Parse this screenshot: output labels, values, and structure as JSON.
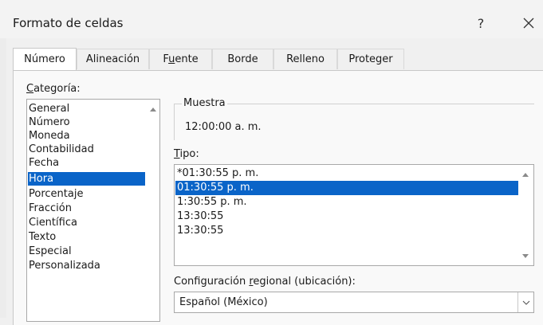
{
  "window": {
    "title": "Formato de celdas",
    "help_label": "?",
    "close_icon": "close-icon"
  },
  "tabs": [
    {
      "label": "Número",
      "active": true
    },
    {
      "label": "Alineación",
      "active": false
    },
    {
      "label_pre": "F",
      "label_u": "u",
      "label_post": "ente",
      "active": false
    },
    {
      "label": "Borde",
      "active": false
    },
    {
      "label": "Relleno",
      "active": false
    },
    {
      "label": "Proteger",
      "active": false
    }
  ],
  "category": {
    "label_u": "C",
    "label_rest": "ategoría:",
    "items": [
      {
        "label": "General"
      },
      {
        "label": "Número"
      },
      {
        "label": "Moneda"
      },
      {
        "label": "Contabilidad"
      },
      {
        "label": "Fecha"
      },
      {
        "label": "Hora",
        "selected": true
      },
      {
        "label": "Porcentaje"
      },
      {
        "label": "Fracción"
      },
      {
        "label": "Científica"
      },
      {
        "label": "Texto"
      },
      {
        "label": "Especial"
      },
      {
        "label": "Personalizada"
      }
    ],
    "selected": "Hora"
  },
  "sample": {
    "legend": "Muestra",
    "value": "12:00:00 a. m."
  },
  "tipo": {
    "label_u": "T",
    "label_rest": "ipo:",
    "items": [
      {
        "label": "*01:30:55 p. m."
      },
      {
        "label": "01:30:55 p. m.",
        "selected": true
      },
      {
        "label": "1:30:55 p. m."
      },
      {
        "label": "13:30:55"
      },
      {
        "label": "13:30:55"
      }
    ],
    "selected": "01:30:55 p. m."
  },
  "regional": {
    "label_pre": "Configuración ",
    "label_u": "r",
    "label_post": "egional (ubicación):",
    "value": "Español (México)"
  },
  "colors": {
    "selection": "#0a64c8",
    "background": "#f0f0f0"
  }
}
